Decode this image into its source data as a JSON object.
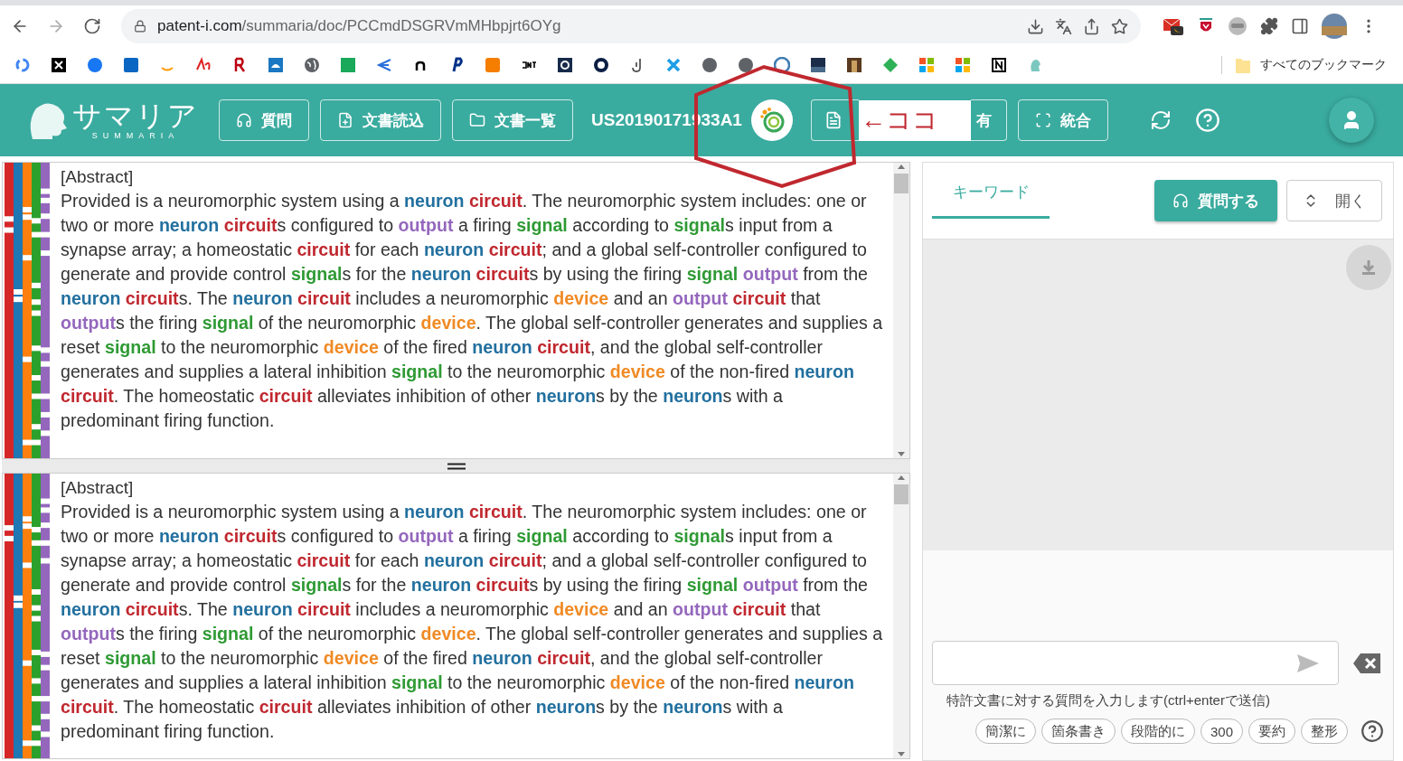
{
  "browser": {
    "url_domain": "patent-i.com",
    "url_path": "/summaria/doc/PCCmdDSGRVmMHbpjrt6OYg",
    "bookmarks_folder": "すべてのブックマーク"
  },
  "header": {
    "logo_text": "サマリア",
    "logo_sub": "SUMMARIA",
    "nav_buttons": [
      {
        "label": "質問"
      },
      {
        "label": "文書読込"
      },
      {
        "label": "文書一覧"
      }
    ],
    "doc_id": "US20190171933A1",
    "tool_buttons": [
      {
        "label": "有"
      },
      {
        "label": "統合"
      }
    ]
  },
  "annotation": {
    "text": "←ココ"
  },
  "panels": [
    {
      "heading": "[Abstract]",
      "segments": [
        "Provided is a neuromorphic system using a ",
        {
          "text": "neuron ",
          "kind": "neuron"
        },
        {
          "text": "circuit",
          "kind": "circuit"
        },
        ". The neuromorphic system includes: one or two or more ",
        {
          "text": "neuron ",
          "kind": "neuron"
        },
        {
          "text": "circuit",
          "kind": "circuit"
        },
        "s configured to ",
        {
          "text": "output",
          "kind": "output"
        },
        " a firing ",
        {
          "text": "signal",
          "kind": "signal"
        },
        " according to ",
        {
          "text": "signal",
          "kind": "signal"
        },
        "s input from a synapse array; a homeostatic ",
        {
          "text": "circuit",
          "kind": "circuit"
        },
        " for each ",
        {
          "text": "neuron ",
          "kind": "neuron"
        },
        {
          "text": "circuit",
          "kind": "circuit"
        },
        "; and a global self-controller configured to generate and provide control ",
        {
          "text": "signal",
          "kind": "signal"
        },
        "s for the ",
        {
          "text": "neuron ",
          "kind": "neuron"
        },
        {
          "text": "circuit",
          "kind": "circuit"
        },
        "s by using the firing ",
        {
          "text": "signal ",
          "kind": "signal"
        },
        {
          "text": "output",
          "kind": "output"
        },
        " from the ",
        {
          "text": "neuron ",
          "kind": "neuron"
        },
        {
          "text": "circuit",
          "kind": "circuit"
        },
        "s. The ",
        {
          "text": "neuron ",
          "kind": "neuron"
        },
        {
          "text": "circuit",
          "kind": "circuit"
        },
        " includes a neuromorphic ",
        {
          "text": "device",
          "kind": "device"
        },
        " and an ",
        {
          "text": "output ",
          "kind": "output"
        },
        {
          "text": "circuit",
          "kind": "circuit"
        },
        " that ",
        {
          "text": "output",
          "kind": "output"
        },
        "s the firing ",
        {
          "text": "signal",
          "kind": "signal"
        },
        " of the neuromorphic ",
        {
          "text": "device",
          "kind": "device"
        },
        ". The global self-controller generates and supplies a reset ",
        {
          "text": "signal",
          "kind": "signal"
        },
        " to the neuromorphic ",
        {
          "text": "device",
          "kind": "device"
        },
        " of the fired ",
        {
          "text": "neuron ",
          "kind": "neuron"
        },
        {
          "text": "circuit",
          "kind": "circuit"
        },
        ", and the global self-controller generates and supplies a lateral inhibition ",
        {
          "text": "signal",
          "kind": "signal"
        },
        " to the neuromorphic ",
        {
          "text": "device",
          "kind": "device"
        },
        " of the non-fired ",
        {
          "text": "neuron ",
          "kind": "neuron"
        },
        {
          "text": "circuit",
          "kind": "circuit"
        },
        ". The homeostatic ",
        {
          "text": "circuit",
          "kind": "circuit"
        },
        " alleviates inhibition of other ",
        {
          "text": "neuron",
          "kind": "neuron"
        },
        "s by the ",
        {
          "text": "neuron",
          "kind": "neuron"
        },
        "s with a predominant firing function."
      ]
    },
    {
      "heading": "[Abstract]",
      "segments": [
        "Provided is a neuromorphic system using a ",
        {
          "text": "neuron ",
          "kind": "neuron"
        },
        {
          "text": "circuit",
          "kind": "circuit"
        },
        ". The neuromorphic system includes: one or two or more ",
        {
          "text": "neuron ",
          "kind": "neuron"
        },
        {
          "text": "circuit",
          "kind": "circuit"
        },
        "s configured to ",
        {
          "text": "output",
          "kind": "output"
        },
        " a firing ",
        {
          "text": "signal",
          "kind": "signal"
        },
        " according to ",
        {
          "text": "signal",
          "kind": "signal"
        },
        "s input from a synapse array; a homeostatic ",
        {
          "text": "circuit",
          "kind": "circuit"
        },
        " for each ",
        {
          "text": "neuron ",
          "kind": "neuron"
        },
        {
          "text": "circuit",
          "kind": "circuit"
        },
        "; and a global self-controller configured to generate and provide control ",
        {
          "text": "signal",
          "kind": "signal"
        },
        "s for the ",
        {
          "text": "neuron ",
          "kind": "neuron"
        },
        {
          "text": "circuit",
          "kind": "circuit"
        },
        "s by using the firing ",
        {
          "text": "signal ",
          "kind": "signal"
        },
        {
          "text": "output",
          "kind": "output"
        },
        " from the ",
        {
          "text": "neuron ",
          "kind": "neuron"
        },
        {
          "text": "circuit",
          "kind": "circuit"
        },
        "s. The ",
        {
          "text": "neuron ",
          "kind": "neuron"
        },
        {
          "text": "circuit",
          "kind": "circuit"
        },
        " includes a neuromorphic ",
        {
          "text": "device",
          "kind": "device"
        },
        " and an ",
        {
          "text": "output ",
          "kind": "output"
        },
        {
          "text": "circuit",
          "kind": "circuit"
        },
        " that ",
        {
          "text": "output",
          "kind": "output"
        },
        "s the firing ",
        {
          "text": "signal",
          "kind": "signal"
        },
        " of the neuromorphic ",
        {
          "text": "device",
          "kind": "device"
        },
        ". The global self-controller generates and supplies a reset ",
        {
          "text": "signal",
          "kind": "signal"
        },
        " to the neuromorphic ",
        {
          "text": "device",
          "kind": "device"
        },
        " of the fired ",
        {
          "text": "neuron ",
          "kind": "neuron"
        },
        {
          "text": "circuit",
          "kind": "circuit"
        },
        ", and the global self-controller generates and supplies a lateral inhibition ",
        {
          "text": "signal",
          "kind": "signal"
        },
        " to the neuromorphic ",
        {
          "text": "device",
          "kind": "device"
        },
        " of the non-fired ",
        {
          "text": "neuron ",
          "kind": "neuron"
        },
        {
          "text": "circuit",
          "kind": "circuit"
        },
        ". The homeostatic ",
        {
          "text": "circuit",
          "kind": "circuit"
        },
        " alleviates inhibition of other ",
        {
          "text": "neuron",
          "kind": "neuron"
        },
        "s by the ",
        {
          "text": "neuron",
          "kind": "neuron"
        },
        "s with a predominant firing function."
      ]
    }
  ],
  "side": {
    "tabs": [
      {
        "label": "キーワード",
        "selected": true
      }
    ],
    "ask_button": "質問する",
    "open_button": "開く",
    "hint": "特許文書に対する質問を入力します(ctrl+enterで送信)",
    "chips": [
      "簡潔に",
      "箇条書き",
      "段階的に",
      "300",
      "要約",
      "整形"
    ]
  }
}
